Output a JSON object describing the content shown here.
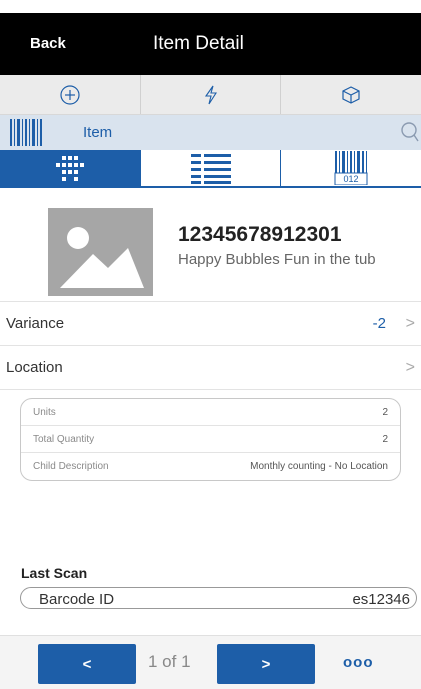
{
  "header": {
    "back_label": "Back",
    "title": "Item Detail"
  },
  "actions": [
    {
      "name": "add-icon"
    },
    {
      "name": "lightning-icon"
    },
    {
      "name": "box-icon"
    }
  ],
  "search": {
    "label": "Item"
  },
  "tabs": [
    {
      "name": "grid-view-icon",
      "active": true
    },
    {
      "name": "list-view-icon",
      "active": false
    },
    {
      "name": "barcode-view-icon",
      "active": false,
      "badge": "012"
    }
  ],
  "item": {
    "sku": "12345678912301",
    "description": "Happy Bubbles Fun in the tub"
  },
  "variance": {
    "label": "Variance",
    "value": "-2"
  },
  "location": {
    "label": "Location"
  },
  "details": [
    {
      "label": "Units",
      "value": "2"
    },
    {
      "label": "Total Quantity",
      "value": "2"
    },
    {
      "label": "Child Description",
      "value": "Monthly counting - No Location"
    }
  ],
  "last_scan": {
    "title": "Last Scan",
    "label": "Barcode ID",
    "value": "es12346"
  },
  "footer": {
    "prev_label": "<",
    "pager": "1 of 1",
    "next_label": ">",
    "more_label": "ooo"
  },
  "colors": {
    "accent": "#1d5ea8",
    "header_bg": "#000000",
    "action_bg": "#ebebeb",
    "search_bg": "#d9e3ee"
  }
}
